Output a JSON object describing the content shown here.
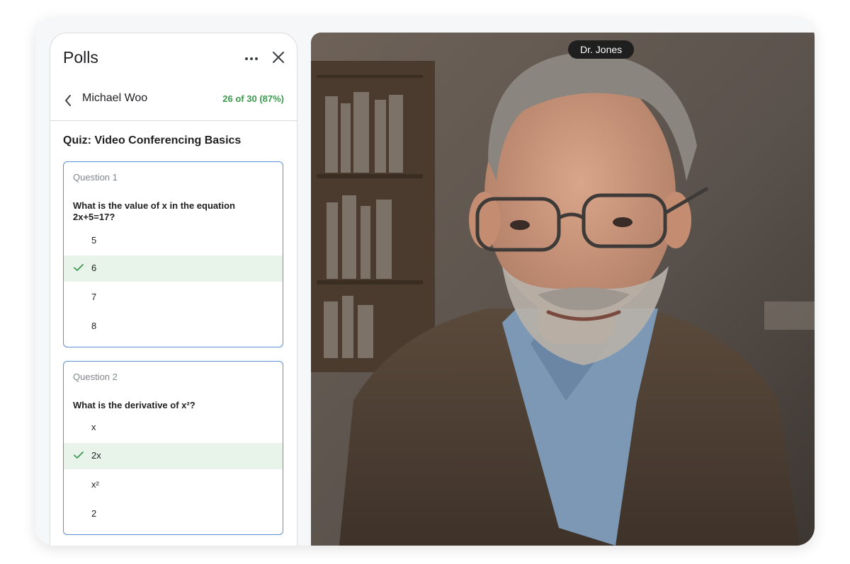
{
  "polls_panel": {
    "title": "Polls",
    "more_icon": "more-horizontal-icon",
    "close_icon": "close-icon",
    "back_icon": "chevron-left-icon",
    "participant": "Michael Woo",
    "score": "26 of 30 (87%)",
    "quiz_title": "Quiz: Video Conferencing Basics",
    "questions": [
      {
        "label": "Question 1",
        "text": "What is the value of x in the equation 2x+5=17?",
        "options": [
          "5",
          "6",
          "7",
          "8"
        ],
        "selected_index": 1
      },
      {
        "label": "Question 2",
        "text": "What is the derivative of x²?",
        "options": [
          "x",
          "2x",
          "x²",
          "2"
        ],
        "selected_index": 1
      }
    ]
  },
  "video": {
    "speaker_name": "Dr. Jones"
  },
  "colors": {
    "accent_green": "#3c9a4f",
    "selected_bg": "#e8f4e9",
    "card_border": "#5b8fd6"
  }
}
